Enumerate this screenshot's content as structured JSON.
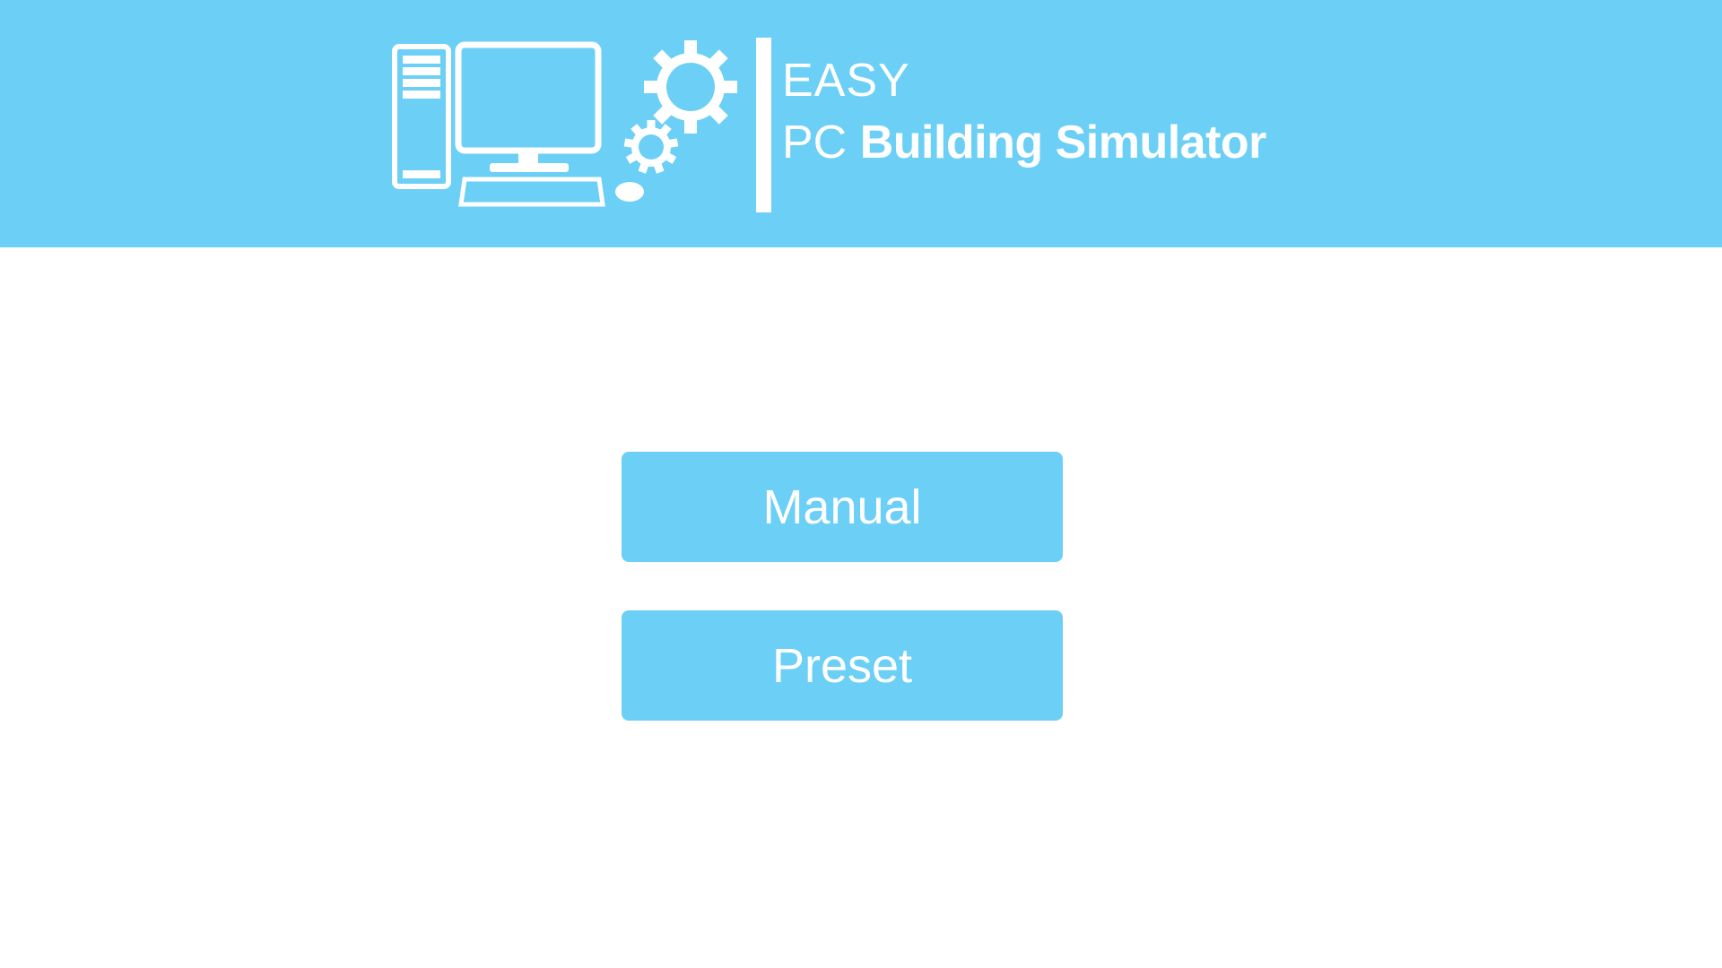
{
  "header": {
    "title_line1": "EASY",
    "title_pc": "PC",
    "title_name": "Building Simulator",
    "logo_icon": "desktop-computer-with-gears",
    "background_color": "#6ccff6"
  },
  "menu": {
    "manual_label": "Manual",
    "preset_label": "Preset",
    "button_color": "#6ccff6",
    "text_color": "#ffffff"
  }
}
